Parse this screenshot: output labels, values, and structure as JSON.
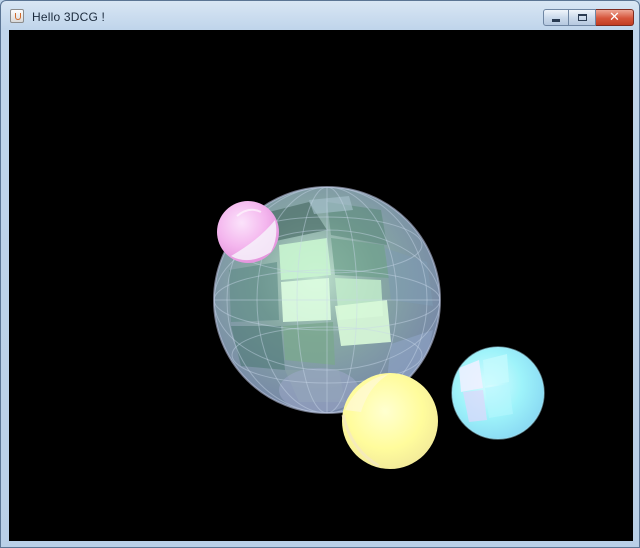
{
  "window": {
    "title": "Hello 3DCG !",
    "icon": "java-cup-icon",
    "controls": {
      "minimize_icon": "minimize-icon",
      "maximize_icon": "maximize-icon",
      "close_icon": "close-icon",
      "close_glyph": "✕"
    }
  },
  "scene": {
    "background": "#000000",
    "spheres": [
      {
        "name": "large-translucent-sphere",
        "color": "#a9c9c2"
      },
      {
        "name": "pink-sphere",
        "color": "#f9c6f2"
      },
      {
        "name": "yellow-sphere",
        "color": "#ffff9e"
      },
      {
        "name": "cyan-sphere",
        "color": "#9ef6fb"
      }
    ]
  }
}
